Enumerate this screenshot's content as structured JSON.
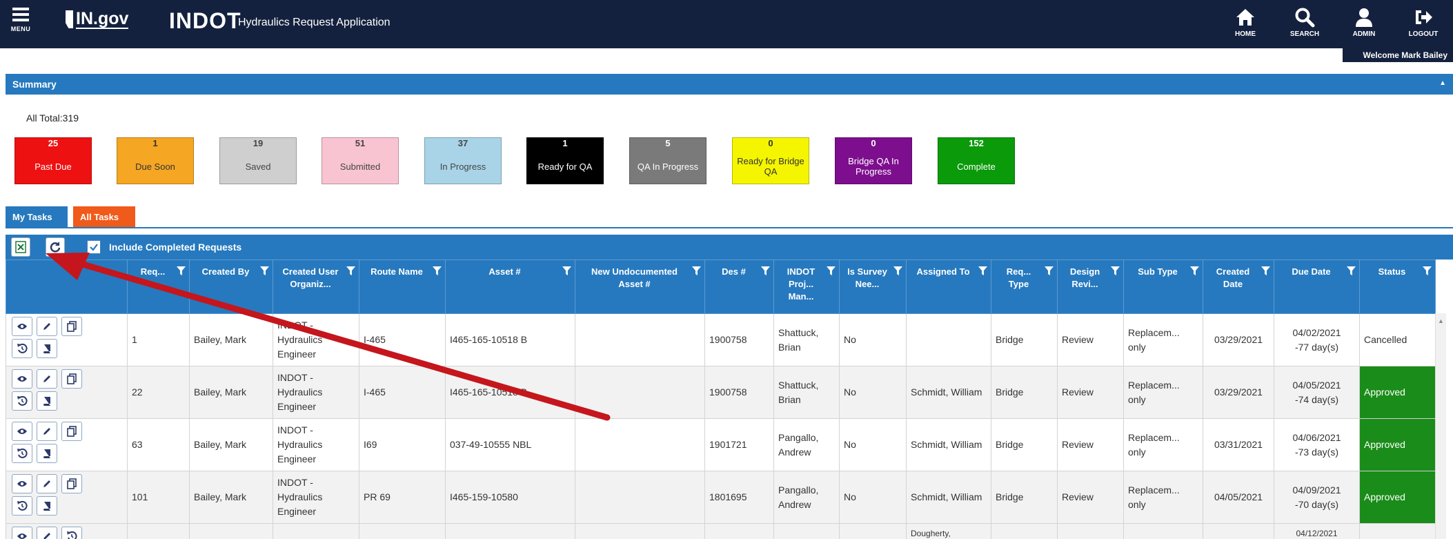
{
  "header": {
    "menu_label": "MENU",
    "ingov_label": "IN.gov",
    "indot_label": "INDOT",
    "app_title": "Hydraulics Request Application",
    "nav": [
      {
        "label": "HOME",
        "icon": "home-icon"
      },
      {
        "label": "SEARCH",
        "icon": "search-icon"
      },
      {
        "label": "ADMIN",
        "icon": "user-icon"
      },
      {
        "label": "LOGOUT",
        "icon": "logout-icon"
      }
    ],
    "welcome": "Welcome Mark Bailey"
  },
  "summary": {
    "title": "Summary",
    "total": "All Total:319",
    "boxes": [
      {
        "count": "25",
        "label": "Past Due",
        "bg": "#ee1111",
        "fg": "#ffffff"
      },
      {
        "count": "1",
        "label": "Due Soon",
        "bg": "#f5a623",
        "fg": "#333333"
      },
      {
        "count": "19",
        "label": "Saved",
        "bg": "#cfcfcf",
        "fg": "#444444"
      },
      {
        "count": "51",
        "label": "Submitted",
        "bg": "#f9c4d2",
        "fg": "#444444"
      },
      {
        "count": "37",
        "label": "In Progress",
        "bg": "#a9d4e8",
        "fg": "#444444"
      },
      {
        "count": "1",
        "label": "Ready for QA",
        "bg": "#000000",
        "fg": "#ffffff"
      },
      {
        "count": "5",
        "label": "QA In Progress",
        "bg": "#7a7a7a",
        "fg": "#ffffff"
      },
      {
        "count": "0",
        "label": "Ready for Bridge QA",
        "bg": "#f5f500",
        "fg": "#333333"
      },
      {
        "count": "0",
        "label": "Bridge QA In Progress",
        "bg": "#7d0e8e",
        "fg": "#ffffff"
      },
      {
        "count": "152",
        "label": "Complete",
        "bg": "#0a9a0a",
        "fg": "#ffffff"
      }
    ]
  },
  "tabs": [
    {
      "label": "My Tasks",
      "color": "#2679be"
    },
    {
      "label": "All Tasks",
      "color": "#f05a1a"
    }
  ],
  "toolbar": {
    "include_completed_label": "Include Completed Requests",
    "include_completed_checked": true
  },
  "columns": [
    "Req...",
    "Created By",
    "Created User Organiz...",
    "Route Name",
    "Asset #",
    "New Undocumented Asset #",
    "Des #",
    "INDOT Proj... Man...",
    "Is Survey Nee...",
    "Assigned To",
    "Req... Type",
    "Design Revi...",
    "Sub Type",
    "Created Date",
    "Due Date",
    "Status"
  ],
  "rows": [
    {
      "req": "1",
      "created_by": "Bailey, Mark",
      "org": "INDOT - Hydraulics Engineer",
      "route": "I-465",
      "asset": "I465-165-10518 B",
      "new_asset": "",
      "des": "1900758",
      "pm": "Shattuck, Brian",
      "survey": "No",
      "assigned": "",
      "req_type": "Bridge",
      "design": "Review",
      "sub_type": "Replacem... only",
      "created": "03/29/2021",
      "due": "04/02/2021",
      "due_days": "-77 day(s)",
      "status": "Cancelled"
    },
    {
      "req": "22",
      "created_by": "Bailey, Mark",
      "org": "INDOT - Hydraulics Engineer",
      "route": "I-465",
      "asset": "I465-165-10518 B",
      "new_asset": "",
      "des": "1900758",
      "pm": "Shattuck, Brian",
      "survey": "No",
      "assigned": "Schmidt, William",
      "req_type": "Bridge",
      "design": "Review",
      "sub_type": "Replacem... only",
      "created": "03/29/2021",
      "due": "04/05/2021",
      "due_days": "-74 day(s)",
      "status": "Approved"
    },
    {
      "req": "63",
      "created_by": "Bailey, Mark",
      "org": "INDOT - Hydraulics Engineer",
      "route": "I69",
      "asset": "037-49-10555 NBL",
      "new_asset": "",
      "des": "1901721",
      "pm": "Pangallo, Andrew",
      "survey": "No",
      "assigned": "Schmidt, William",
      "req_type": "Bridge",
      "design": "Review",
      "sub_type": "Replacem... only",
      "created": "03/31/2021",
      "due": "04/06/2021",
      "due_days": "-73 day(s)",
      "status": "Approved"
    },
    {
      "req": "101",
      "created_by": "Bailey, Mark",
      "org": "INDOT - Hydraulics Engineer",
      "route": "PR 69",
      "asset": "I465-159-10580",
      "new_asset": "",
      "des": "1801695",
      "pm": "Pangallo, Andrew",
      "survey": "No",
      "assigned": "Schmidt, William",
      "req_type": "Bridge",
      "design": "Review",
      "sub_type": "Replacem... only",
      "created": "04/05/2021",
      "due": "04/09/2021",
      "due_days": "-70 day(s)",
      "status": "Approved"
    }
  ],
  "partial_row": {
    "assigned": "Dougherty,",
    "due": "04/12/2021"
  },
  "annotation": {
    "arrow_color": "#c4161c"
  }
}
